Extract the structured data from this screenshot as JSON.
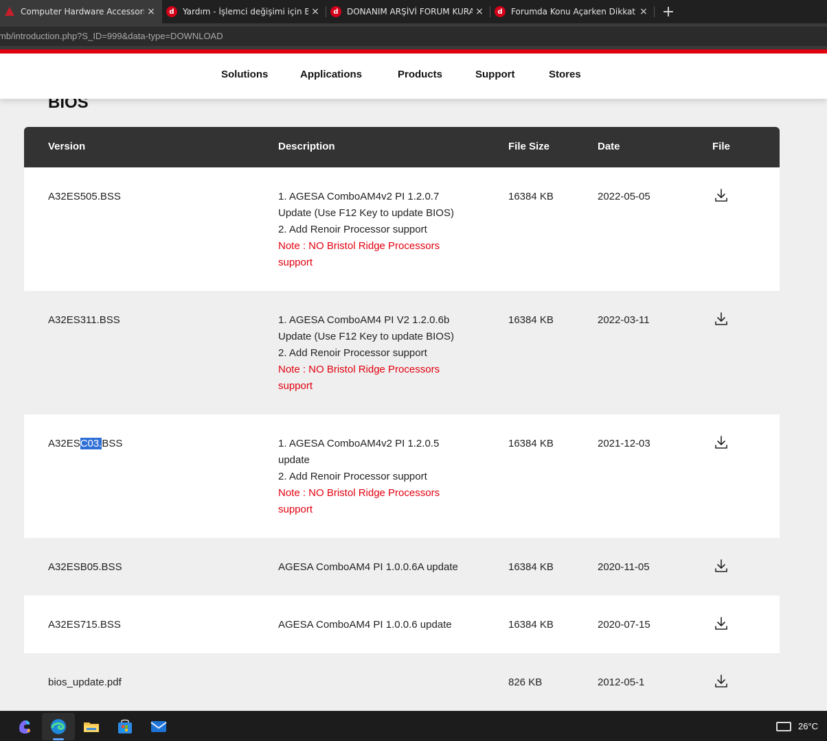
{
  "browser": {
    "tabs": [
      {
        "title": "Computer Hardware Accessories,",
        "active": true,
        "favicon": "asrock-triangle-icon"
      },
      {
        "title": "Yardım - İşlemci değişimi için BIOS",
        "active": false,
        "favicon": "donanim-arsivi-icon"
      },
      {
        "title": "DONANIM ARŞİVİ FORUM KURALL",
        "active": false,
        "favicon": "donanim-arsivi-icon"
      },
      {
        "title": "Forumda Konu Açarken Dikkat Et",
        "active": false,
        "favicon": "donanim-arsivi-icon"
      }
    ],
    "new_tab": "+",
    "close_glyph": "×",
    "url": "mb/introduction.php?S_ID=999&data-type=DOWNLOAD"
  },
  "nav": {
    "items": [
      "Solutions",
      "Applications",
      "Products",
      "Support",
      "Stores"
    ]
  },
  "page": {
    "heading": "BIOS"
  },
  "table": {
    "headers": {
      "version": "Version",
      "description": "Description",
      "size": "File Size",
      "date": "Date",
      "file": "File"
    },
    "rows": [
      {
        "version_pre": "A32ES505.BSS",
        "version_hl": "",
        "version_post": "",
        "desc": [
          "1. AGESA ComboAM4v2 PI 1.2.0.7",
          "Update (Use F12 Key to update BIOS)",
          "2. Add Renoir Processor support"
        ],
        "note": [
          "Note : NO Bristol Ridge Processors",
          "support"
        ],
        "size": "16384 KB",
        "date": "2022-05-05"
      },
      {
        "version_pre": "A32ES311.BSS",
        "version_hl": "",
        "version_post": "",
        "desc": [
          "1. AGESA ComboAM4 PI V2 1.2.0.6b",
          "Update (Use F12 Key to update BIOS)",
          "2. Add Renoir Processor support"
        ],
        "note": [
          "Note : NO Bristol Ridge Processors",
          "support"
        ],
        "size": "16384 KB",
        "date": "2022-03-11"
      },
      {
        "version_pre": "A32ES",
        "version_hl": "C03.",
        "version_post": "BSS",
        "desc": [
          "1. AGESA ComboAM4v2 PI 1.2.0.5",
          "update",
          "2. Add Renoir Processor support"
        ],
        "note": [
          "Note : NO Bristol Ridge Processors",
          "support"
        ],
        "size": "16384 KB",
        "date": "2021-12-03"
      },
      {
        "version_pre": "A32ESB05.BSS",
        "version_hl": "",
        "version_post": "",
        "desc": [
          "AGESA ComboAM4 PI 1.0.0.6A update"
        ],
        "note": [],
        "size": "16384 KB",
        "date": "2020-11-05"
      },
      {
        "version_pre": "A32ES715.BSS",
        "version_hl": "",
        "version_post": "",
        "desc": [
          "AGESA ComboAM4 PI 1.0.0.6 update"
        ],
        "note": [],
        "size": "16384 KB",
        "date": "2020-07-15"
      },
      {
        "version_pre": "bios_update.pdf",
        "version_hl": "",
        "version_post": "",
        "desc": [],
        "note": [],
        "size": "826 KB",
        "date": "2012-05-1"
      }
    ]
  },
  "taskbar": {
    "apps": [
      "copilot-icon",
      "edge-icon",
      "file-explorer-icon",
      "store-icon",
      "mail-icon"
    ],
    "temperature": "26°C"
  },
  "colors": {
    "accent_red": "#e2000f",
    "header_dark": "#333333",
    "selection": "#2f6fd6"
  }
}
